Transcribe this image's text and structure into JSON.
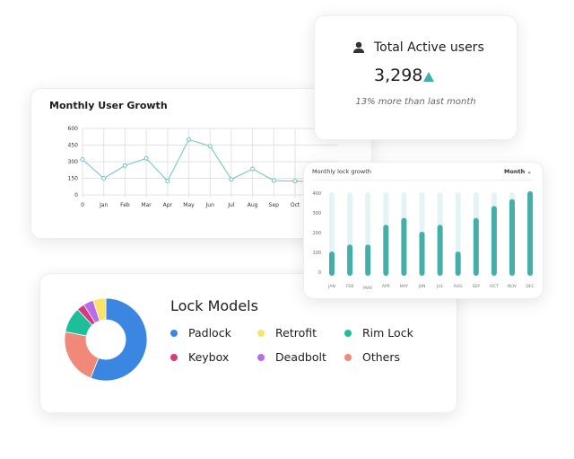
{
  "users_card": {
    "title": "Total Active users",
    "value": "3,298",
    "trend_icon": "triangle-up",
    "change_text": "13% more than last month",
    "accent": "#3fb1aa"
  },
  "line_chart": {
    "chart_data": {
      "type": "line",
      "title": "Monthly User Growth",
      "categories": [
        "0",
        "Jan",
        "Feb",
        "Mar",
        "Apr",
        "May",
        "Jun",
        "Jul",
        "Aug",
        "Sep",
        "Oct"
      ],
      "values": [
        320,
        150,
        265,
        330,
        125,
        500,
        440,
        140,
        235,
        130,
        125
      ],
      "yticks": [
        "0",
        "150",
        "300",
        "450",
        "600"
      ],
      "ylim": [
        0,
        600
      ],
      "grid": true,
      "color": "#6cc3c3"
    }
  },
  "bar_chart": {
    "chart_data": {
      "type": "bar",
      "title": "Monthly lock growth",
      "categories": [
        "JAN",
        "FEB",
        "MAR",
        "APR",
        "MAY",
        "JUN",
        "JUL",
        "AUG",
        "SEP",
        "OCT",
        "NOV",
        "DEC"
      ],
      "values": [
        100,
        135,
        135,
        235,
        270,
        200,
        235,
        100,
        270,
        330,
        365,
        405
      ],
      "yticks": [
        "0",
        "100",
        "200",
        "300",
        "400"
      ],
      "ylim": [
        0,
        400
      ],
      "color": "#45aea8"
    },
    "period_select": "Month"
  },
  "donut_chart": {
    "chart_data": {
      "type": "pie",
      "title": "Lock Models",
      "slices": [
        {
          "name": "Padlock",
          "value": 56,
          "color": "#3b86e0"
        },
        {
          "name": "Others",
          "value": 22,
          "color": "#f0897a"
        },
        {
          "name": "Rim Lock",
          "value": 10,
          "color": "#1dbf9b"
        },
        {
          "name": "Keybox",
          "value": 3,
          "color": "#d63a7b"
        },
        {
          "name": "Deadbolt",
          "value": 4,
          "color": "#b76ce8"
        },
        {
          "name": "Retrofit",
          "value": 5,
          "color": "#fde26a"
        }
      ],
      "legend_order": [
        "Padlock",
        "Retrofit",
        "Rim Lock",
        "Keybox",
        "Deadbolt",
        "Others"
      ]
    }
  }
}
